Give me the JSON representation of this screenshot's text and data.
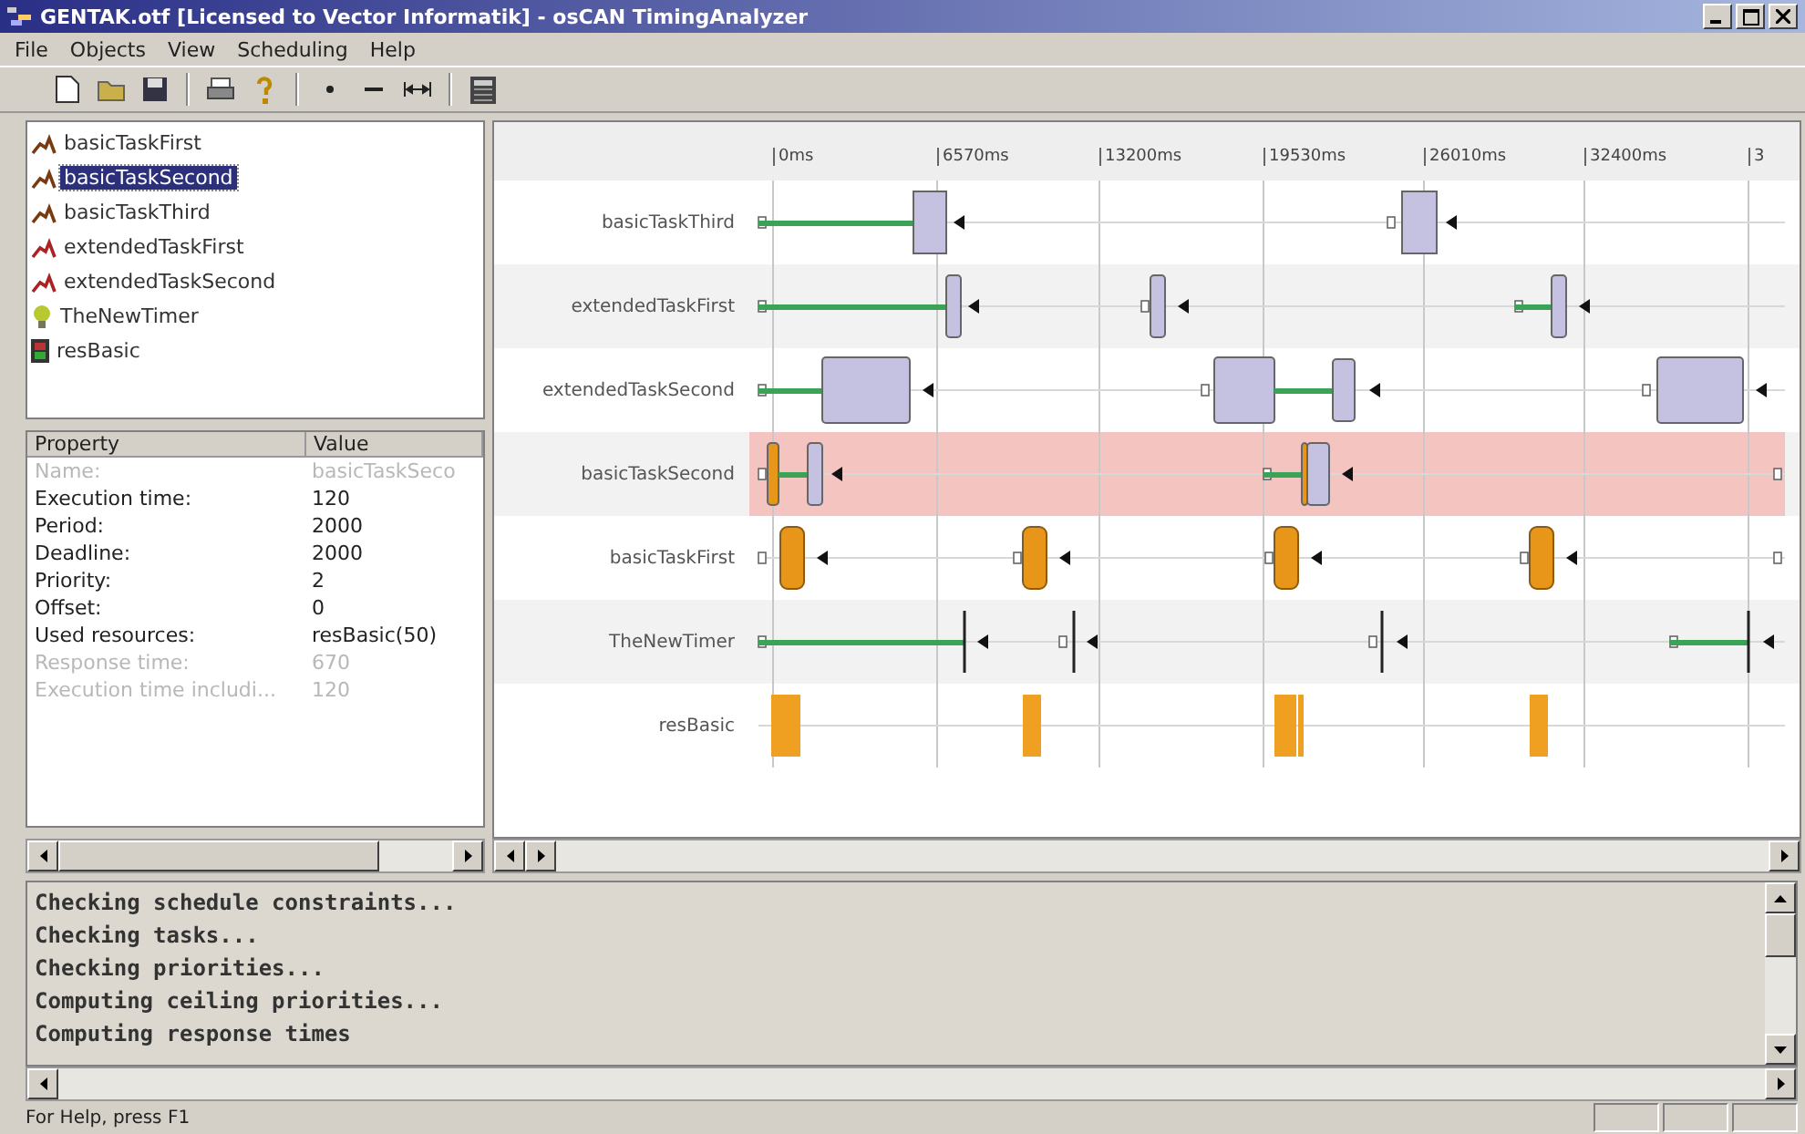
{
  "window": {
    "title": "GENTAK.otf [Licensed to Vector Informatik] - osCAN TimingAnalyzer"
  },
  "menu": [
    {
      "label": "File"
    },
    {
      "label": "Objects"
    },
    {
      "label": "View"
    },
    {
      "label": "Scheduling"
    },
    {
      "label": "Help"
    }
  ],
  "objects": [
    {
      "label": "basicTaskFirst",
      "kind": "task",
      "selected": false
    },
    {
      "label": "basicTaskSecond",
      "kind": "task",
      "selected": true
    },
    {
      "label": "basicTaskThird",
      "kind": "task",
      "selected": false
    },
    {
      "label": "extendedTaskFirst",
      "kind": "task",
      "selected": false
    },
    {
      "label": "extendedTaskSecond",
      "kind": "task",
      "selected": false
    },
    {
      "label": "TheNewTimer",
      "kind": "timer",
      "selected": false
    },
    {
      "label": "resBasic",
      "kind": "resource",
      "selected": false
    }
  ],
  "properties": {
    "columns": [
      "Property",
      "Value"
    ],
    "rows": [
      {
        "property": "Name:",
        "value": "basicTaskSeco",
        "disabled": true
      },
      {
        "property": "Execution time:",
        "value": "120",
        "disabled": false
      },
      {
        "property": "Period:",
        "value": "2000",
        "disabled": false
      },
      {
        "property": "Deadline:",
        "value": "2000",
        "disabled": false
      },
      {
        "property": "Priority:",
        "value": "2",
        "disabled": false
      },
      {
        "property": "Offset:",
        "value": "0",
        "disabled": false
      },
      {
        "property": "Used resources:",
        "value": "resBasic(50)",
        "disabled": false
      },
      {
        "property": "Response time:",
        "value": "670",
        "disabled": true
      },
      {
        "property": "Execution time includi...",
        "value": "120",
        "disabled": true
      }
    ]
  },
  "timeline": {
    "ticks": [
      "0ms",
      "6570ms",
      "13200ms",
      "19530ms",
      "26010ms",
      "32400ms",
      "3"
    ],
    "rows": [
      {
        "label": "basicTaskThird",
        "selected": false
      },
      {
        "label": "extendedTaskFirst",
        "selected": false
      },
      {
        "label": "extendedTaskSecond",
        "selected": false
      },
      {
        "label": "basicTaskSecond",
        "selected": true
      },
      {
        "label": "basicTaskFirst",
        "selected": false
      },
      {
        "label": "TheNewTimer",
        "selected": false
      },
      {
        "label": "resBasic",
        "selected": false
      }
    ]
  },
  "log": [
    "Checking schedule constraints...",
    "Checking tasks...",
    "Checking priorities...",
    "Computing ceiling priorities...",
    "Computing response times"
  ],
  "status_bar": {
    "text": "For Help, press F1"
  }
}
